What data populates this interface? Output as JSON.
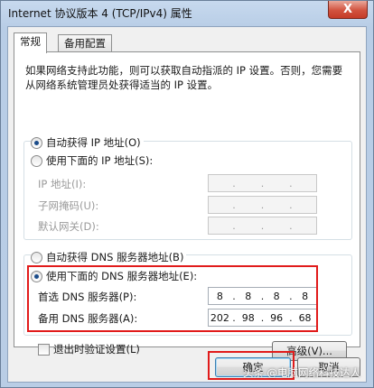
{
  "window": {
    "title": "Internet 协议版本 4 (TCP/IPv4) 属性",
    "close_glyph": "X"
  },
  "tabs": [
    {
      "label": "常规",
      "active": true
    },
    {
      "label": "备用配置",
      "active": false
    }
  ],
  "description": "如果网络支持此功能，则可以获取自动指派的 IP 设置。否则，您需要从网络系统管理员处获得适当的 IP 设置。",
  "ip": {
    "auto_label": "自动获得 IP 地址(O)",
    "auto_checked": true,
    "manual_label": "使用下面的 IP 地址(S):",
    "manual_checked": false,
    "fields": [
      {
        "label": "IP 地址(I):",
        "value": [
          "",
          "",
          "",
          ""
        ]
      },
      {
        "label": "子网掩码(U):",
        "value": [
          "",
          "",
          "",
          ""
        ]
      },
      {
        "label": "默认网关(D):",
        "value": [
          "",
          "",
          "",
          ""
        ]
      }
    ]
  },
  "dns": {
    "auto_label": "自动获得 DNS 服务器地址(B)",
    "auto_checked": false,
    "manual_label": "使用下面的 DNS 服务器地址(E):",
    "manual_checked": true,
    "preferred_label": "首选 DNS 服务器(P):",
    "preferred_value": [
      "8",
      "8",
      "8",
      "8"
    ],
    "alternate_label": "备用 DNS 服务器(A):",
    "alternate_value": [
      "202",
      "98",
      "96",
      "68"
    ]
  },
  "validate_on_exit": {
    "label": "退出时验证设置(L)",
    "checked": false
  },
  "buttons": {
    "advanced": "高级(V)...",
    "ok": "确定",
    "cancel": "取消"
  },
  "watermark": "头条 @电脑网络科技达人",
  "colors": {
    "highlight": "#e11b1b",
    "accent": "#3c7fb1"
  }
}
